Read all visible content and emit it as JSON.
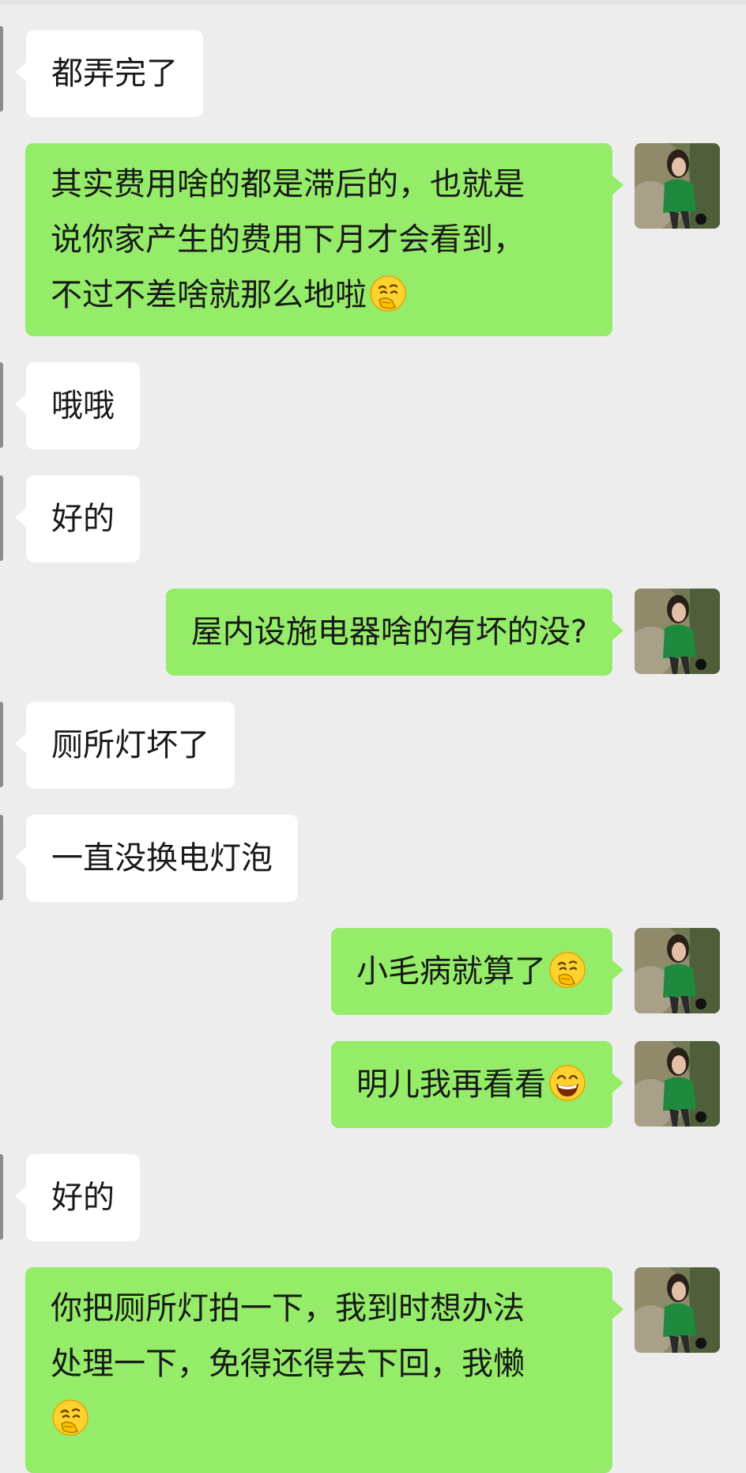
{
  "messages": [
    {
      "side": "in",
      "lines": [
        {
          "text": "都弄完了",
          "emoji": null
        }
      ]
    },
    {
      "side": "out",
      "lines": [
        {
          "text": "其实费用啥的都是滞后的，也就是",
          "emoji": null
        },
        {
          "text": "说你家产生的费用下月才会看到，",
          "emoji": null
        },
        {
          "text": "不过不差啥就那么地啦",
          "emoji": "thinking-face-emoji"
        }
      ]
    },
    {
      "side": "in",
      "lines": [
        {
          "text": "哦哦",
          "emoji": null
        }
      ]
    },
    {
      "side": "in",
      "lines": [
        {
          "text": "好的",
          "emoji": null
        }
      ]
    },
    {
      "side": "out",
      "lines": [
        {
          "text": "屋内设施电器啥的有坏的没?",
          "emoji": null
        }
      ]
    },
    {
      "side": "in",
      "lines": [
        {
          "text": "厕所灯坏了",
          "emoji": null
        }
      ]
    },
    {
      "side": "in",
      "lines": [
        {
          "text": "一直没换电灯泡",
          "emoji": null
        }
      ]
    },
    {
      "side": "out",
      "lines": [
        {
          "text": "小毛病就算了",
          "emoji": "thinking-face-emoji"
        }
      ]
    },
    {
      "side": "out",
      "lines": [
        {
          "text": "明儿我再看看",
          "emoji": "grinning-face-emoji"
        }
      ]
    },
    {
      "side": "in",
      "lines": [
        {
          "text": "好的",
          "emoji": null
        }
      ]
    },
    {
      "side": "out",
      "lines": [
        {
          "text": "你把厕所灯拍一下，我到时想办法",
          "emoji": null
        },
        {
          "text": "处理一下，免得还得去下回，我懒",
          "emoji": null
        },
        {
          "text": "",
          "emoji": "thinking-face-emoji"
        }
      ]
    }
  ],
  "colors": {
    "background": "#ededed",
    "incoming_bubble": "#ffffff",
    "outgoing_bubble": "#95ec69",
    "text": "#191919"
  },
  "icons": {
    "avatar": "avatar-photo",
    "thinking": "thinking-face-emoji",
    "grinning": "grinning-face-emoji"
  }
}
